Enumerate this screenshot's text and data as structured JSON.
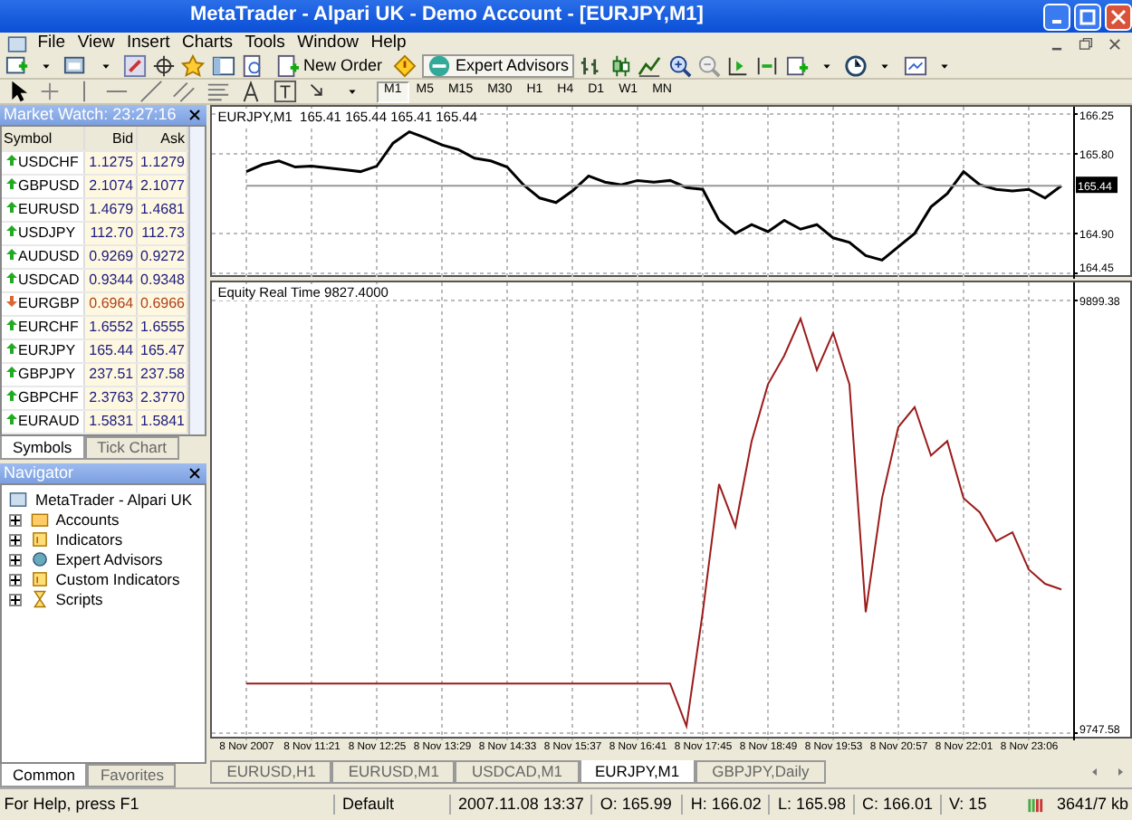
{
  "window": {
    "title": "MetaTrader - Alpari UK - Demo Account - [EURJPY,M1]"
  },
  "menu": [
    "File",
    "View",
    "Insert",
    "Charts",
    "Tools",
    "Window",
    "Help"
  ],
  "toolbar": {
    "buttons": [
      "New Order",
      "Expert Advisors"
    ]
  },
  "timeframes": [
    {
      "label": "M1",
      "selected": true
    },
    {
      "label": "M5",
      "selected": false
    },
    {
      "label": "M15",
      "selected": false
    },
    {
      "label": "M30",
      "selected": false
    },
    {
      "label": "H1",
      "selected": false
    },
    {
      "label": "H4",
      "selected": false
    },
    {
      "label": "D1",
      "selected": false
    },
    {
      "label": "W1",
      "selected": false
    },
    {
      "label": "MN",
      "selected": false
    }
  ],
  "market_watch": {
    "title": "Market Watch: 23:27:16",
    "columns": [
      "Symbol",
      "Bid",
      "Ask"
    ],
    "rows": [
      {
        "symbol": "USDCHF",
        "bid": "1.1275",
        "ask": "1.1279",
        "down": false
      },
      {
        "symbol": "GBPUSD",
        "bid": "2.1074",
        "ask": "2.1077",
        "down": false
      },
      {
        "symbol": "EURUSD",
        "bid": "1.4679",
        "ask": "1.4681",
        "down": false
      },
      {
        "symbol": "USDJPY",
        "bid": "112.70",
        "ask": "112.73",
        "down": false
      },
      {
        "symbol": "AUDUSD",
        "bid": "0.9269",
        "ask": "0.9272",
        "down": false
      },
      {
        "symbol": "USDCAD",
        "bid": "0.9344",
        "ask": "0.9348",
        "down": false
      },
      {
        "symbol": "EURGBP",
        "bid": "0.6964",
        "ask": "0.6966",
        "down": true
      },
      {
        "symbol": "EURCHF",
        "bid": "1.6552",
        "ask": "1.6555",
        "down": false
      },
      {
        "symbol": "EURJPY",
        "bid": "165.44",
        "ask": "165.47",
        "down": false
      },
      {
        "symbol": "GBPJPY",
        "bid": "237.51",
        "ask": "237.58",
        "down": false
      },
      {
        "symbol": "GBPCHF",
        "bid": "2.3763",
        "ask": "2.3770",
        "down": false
      },
      {
        "symbol": "EURAUD",
        "bid": "1.5831",
        "ask": "1.5841",
        "down": false
      }
    ],
    "tabs": [
      {
        "label": "Symbols",
        "selected": true
      },
      {
        "label": "Tick Chart",
        "selected": false
      }
    ]
  },
  "navigator": {
    "title": "Navigator",
    "tree": [
      {
        "label": "MetaTrader - Alpari UK",
        "children": [
          {
            "label": "Accounts",
            "expanded": false
          },
          {
            "label": "Indicators",
            "expanded": false
          },
          {
            "label": "Expert Advisors",
            "expanded": false
          },
          {
            "label": "Custom Indicators",
            "expanded": false
          },
          {
            "label": "Scripts",
            "expanded": false
          }
        ]
      }
    ],
    "tabs": [
      {
        "label": "Common",
        "selected": true
      },
      {
        "label": "Favorites",
        "selected": false
      }
    ]
  },
  "charts": [
    {
      "title": "EURJPY,M1  165.41 165.44 165.41 165.44",
      "chart_data": {
        "type": "line",
        "grid": true,
        "yticks": [
          166.25,
          {
            "value": 165.8,
            "label": "165.80"
          },
          {
            "value": 165.44,
            "label": "165.44"
          },
          {
            "value": 164.9,
            "label": "164.90"
          },
          164.45
        ],
        "ylim": [
          164.45,
          166.25
        ],
        "series": [
          {
            "color": "#000000",
            "values": [
              165.6,
              165.68,
              165.72,
              165.65,
              165.66,
              165.64,
              165.62,
              165.6,
              165.66,
              165.92,
              166.05,
              165.98,
              165.9,
              165.85,
              165.75,
              165.72,
              165.65,
              165.45,
              165.3,
              165.25,
              165.38,
              165.55,
              165.48,
              165.45,
              165.5,
              165.48,
              165.5,
              165.42,
              165.4,
              165.05,
              164.9,
              165.0,
              164.92,
              165.05,
              164.95,
              165.0,
              164.85,
              164.8,
              164.65,
              164.6,
              164.75,
              164.9,
              165.2,
              165.35,
              165.6,
              165.45,
              165.4,
              165.38,
              165.4,
              165.3,
              165.44
            ]
          },
          {
            "color": "#999999",
            "values": [
              165.44,
              165.44,
              165.44,
              165.44,
              165.44,
              165.44,
              165.44,
              165.44,
              165.44,
              165.44,
              165.44,
              165.44,
              165.44,
              165.44,
              165.44,
              165.44,
              165.44,
              165.44,
              165.44,
              165.44,
              165.44,
              165.44,
              165.44,
              165.44,
              165.44,
              165.44,
              165.44,
              165.44,
              165.44,
              165.44,
              165.44,
              165.44,
              165.44,
              165.44,
              165.44,
              165.44,
              165.44,
              165.44,
              165.44,
              165.44,
              165.44,
              165.44,
              165.44,
              165.44,
              165.44,
              165.44,
              165.44,
              165.44,
              165.44,
              165.44,
              165.44
            ]
          }
        ]
      }
    },
    {
      "title": "Equity Real Time 9827.4000",
      "chart_data": {
        "type": "line",
        "grid": true,
        "categories": [
          "8 Nov 2007",
          null,
          null,
          null,
          "8 Nov 11:21",
          null,
          null,
          null,
          "8 Nov 12:25",
          null,
          null,
          null,
          "8 Nov 13:29",
          null,
          null,
          null,
          "8 Nov 14:33",
          null,
          null,
          null,
          "8 Nov 15:37",
          null,
          null,
          null,
          "8 Nov 16:41",
          null,
          null,
          null,
          "8 Nov 17:45",
          null,
          null,
          null,
          "8 Nov 18:49",
          null,
          null,
          null,
          "8 Nov 19:53",
          null,
          null,
          null,
          "8 Nov 20:57",
          null,
          null,
          null,
          "8 Nov 22:01",
          null,
          null,
          null,
          "8 Nov 23:06",
          null,
          null
        ],
        "yticks": [
          9899.38,
          9747.58
        ],
        "ylim": [
          9747.58,
          9899.38
        ],
        "series": [
          {
            "color": "#9b1c1c",
            "values": [
              9765,
              9765,
              9765,
              9765,
              9765,
              9765,
              9765,
              9765,
              9765,
              9765,
              9765,
              9765,
              9765,
              9765,
              9765,
              9765,
              9765,
              9765,
              9765,
              9765,
              9765,
              9765,
              9765,
              9765,
              9765,
              9765,
              9765,
              9750,
              9790,
              9835,
              9820,
              9850,
              9870,
              9880,
              9893,
              9875,
              9888,
              9870,
              9790,
              9830,
              9855,
              9862,
              9845,
              9850,
              9830,
              9825,
              9815,
              9818,
              9805,
              9800,
              9798
            ]
          }
        ]
      }
    }
  ],
  "chart_tabs": [
    {
      "label": "EURUSD,H1",
      "selected": false
    },
    {
      "label": "EURUSD,M1",
      "selected": false
    },
    {
      "label": "USDCAD,M1",
      "selected": false
    },
    {
      "label": "EURJPY,M1",
      "selected": true
    },
    {
      "label": "GBPJPY,Daily",
      "selected": false
    }
  ],
  "status_bar": {
    "help": "For Help, press F1",
    "fields": [
      "Default",
      "2007.11.08 13:37",
      "O: 165.99",
      "H: 166.02",
      "L: 165.98",
      "C: 166.01",
      "V: 15"
    ],
    "traffic": "3641/7 kb"
  }
}
